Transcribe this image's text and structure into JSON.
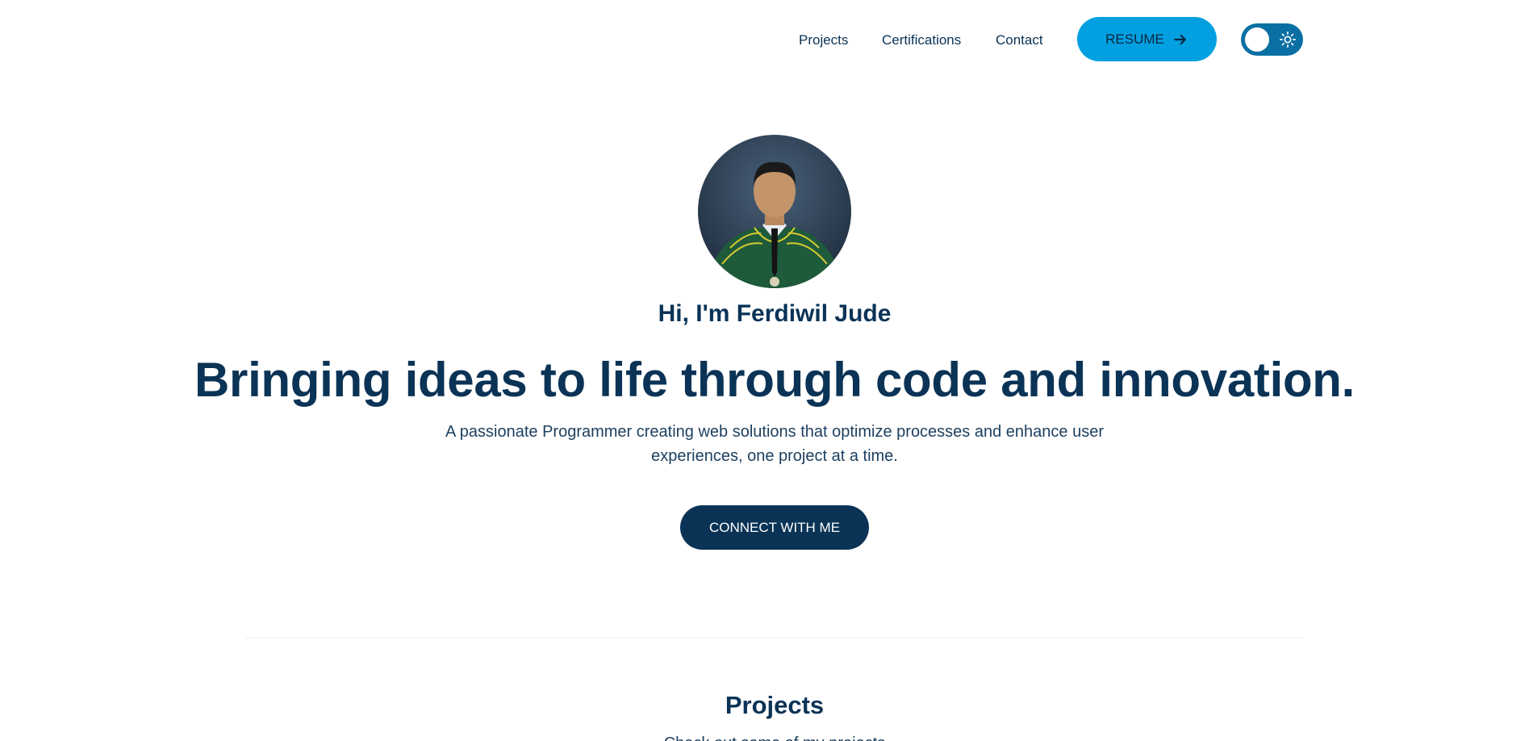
{
  "nav": {
    "links": [
      {
        "label": "Projects"
      },
      {
        "label": "Certifications"
      },
      {
        "label": "Contact"
      }
    ],
    "resume_label": "RESUME",
    "resume_icon": "arrow-right-icon",
    "theme_toggle_icon": "sun-icon"
  },
  "hero": {
    "avatar_icon": "profile-photo",
    "greeting": "Hi, I'm Ferdiwil Jude",
    "headline": "Bringing ideas to life through code and innovation.",
    "subtext": "A passionate Programmer creating web solutions that optimize processes and enhance user experiences, one project at a time.",
    "cta_label": "CONNECT WITH ME"
  },
  "projects": {
    "title": "Projects",
    "subtitle": "Check out some of my projects"
  },
  "colors": {
    "primary": "#0a3356",
    "accent": "#02a0e0",
    "toggle": "#0a6fa2",
    "background": "#ffffff"
  }
}
